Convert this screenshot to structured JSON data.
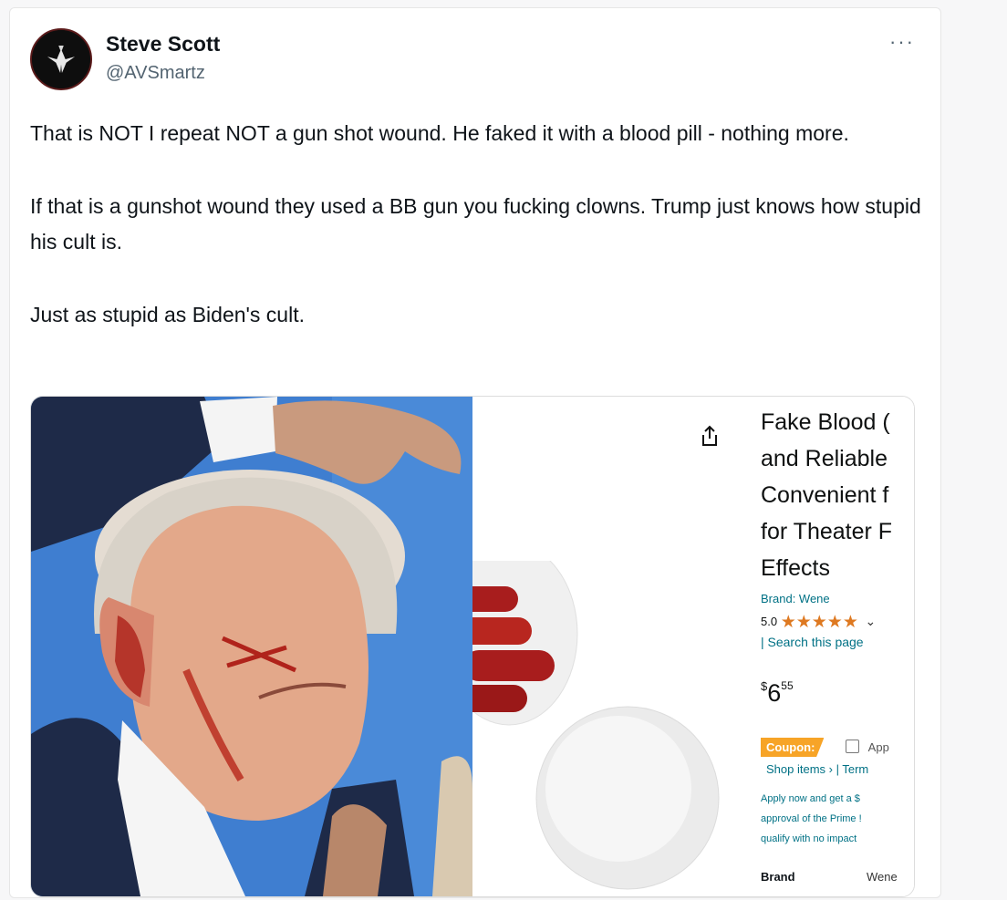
{
  "tweet": {
    "author_name": "Steve Scott",
    "author_handle": "@AVSmartz",
    "more_label": "···",
    "paragraphs": [
      "That is NOT I repeat NOT a gun shot wound. He faked it with a blood pill - nothing more.",
      "If that is a gunshot wound they used a BB gun you fucking clowns. Trump just knows how stupid his cult is.",
      "Just as stupid as Biden's cult."
    ]
  },
  "product": {
    "title_lines": [
      "Fake Blood (",
      "and Reliable",
      "Convenient f",
      "for Theater F",
      "Effects"
    ],
    "brand": "Brand: Wene",
    "rating_value": "5.0",
    "stars": "★★★★★",
    "search_link": "| Search this page",
    "price_currency": "$",
    "price_whole": "6",
    "price_fraction": "55",
    "coupon_label": "Coupon:",
    "apply_label": "App",
    "shop_items": "Shop items › | Term",
    "fine_print": [
      "Apply now and get a $",
      "approval of the Prime !",
      "qualify with no impact"
    ],
    "brand_key": "Brand",
    "brand_value": "Wene"
  },
  "colors": {
    "amazon_link": "#007185",
    "star": "#de7921",
    "coupon": "#f7a427",
    "sky": "#3f7ed0",
    "pill": "#a81d1d"
  },
  "icons": {
    "share": "share-icon",
    "avatar": "bird-logo-icon"
  }
}
